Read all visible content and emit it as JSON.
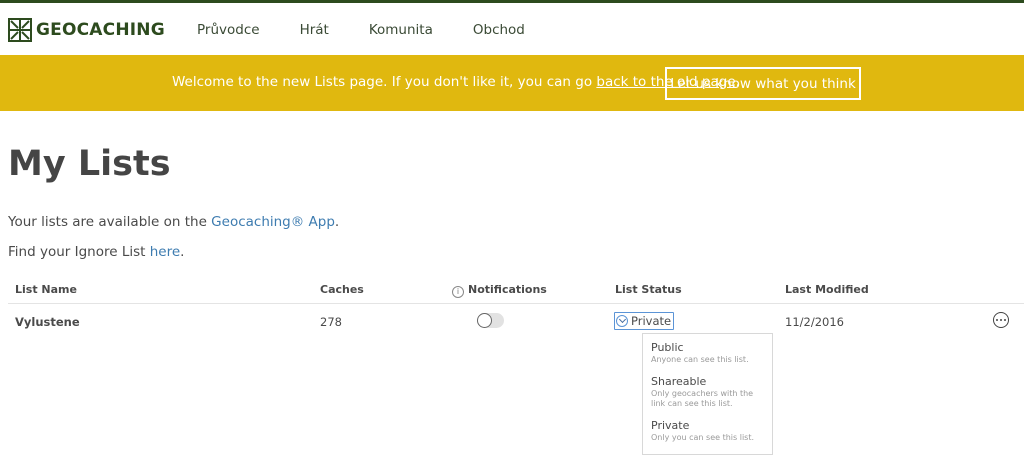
{
  "header": {
    "logo_text": "GEOCACHING",
    "nav": [
      "Průvodce",
      "Hrát",
      "Komunita",
      "Obchod"
    ]
  },
  "banner": {
    "text_before": "Welcome to the new Lists page. If you don't like it, you can go ",
    "link_text": "back to the old page",
    "text_after": ".",
    "button_label": "Let us know what you think"
  },
  "main": {
    "title": "My Lists",
    "line1_before": "Your lists are available on the ",
    "line1_link": "Geocaching® App",
    "line1_after": ".",
    "line2_before": "Find your Ignore List ",
    "line2_link": "here",
    "line2_after": "."
  },
  "table": {
    "columns": {
      "name": "List Name",
      "caches": "Caches",
      "notifications": "Notifications",
      "status": "List Status",
      "modified": "Last Modified"
    },
    "rows": [
      {
        "name": "Vylustene",
        "caches": "278",
        "notifications_on": false,
        "status": "Private",
        "modified": "11/2/2016"
      }
    ]
  },
  "status_dropdown": {
    "options": [
      {
        "title": "Public",
        "desc": "Anyone can see this list."
      },
      {
        "title": "Shareable",
        "desc_lines": [
          "Only geocachers with the",
          "link can see this list."
        ]
      },
      {
        "title": "Private",
        "desc": "Only you can see this list."
      }
    ]
  },
  "icons": {
    "logo": "geocaching-logo-icon",
    "info": "info-icon",
    "chevron": "chevron-down-icon",
    "more": "more-options-icon"
  },
  "colors": {
    "brand_green": "#2d4b1e",
    "banner_yellow": "#e0b80f",
    "link_blue": "#3e7cb0",
    "focus_blue": "#5b94d6"
  }
}
